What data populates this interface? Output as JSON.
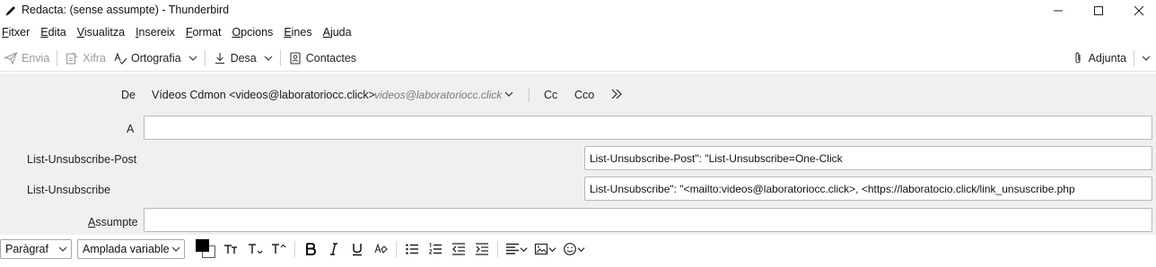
{
  "window": {
    "title": "Redacta: (sense assumpte) - Thunderbird"
  },
  "menubar": {
    "items": [
      {
        "accel": "F",
        "rest": "itxer"
      },
      {
        "accel": "E",
        "rest": "dita"
      },
      {
        "accel": "V",
        "rest": "isualitza"
      },
      {
        "accel": "I",
        "rest": "nsereix"
      },
      {
        "accel": "F",
        "rest": "ormat"
      },
      {
        "accel": "O",
        "rest": "pcions"
      },
      {
        "accel": "E",
        "rest": "ines"
      },
      {
        "accel": "A",
        "rest": "juda"
      }
    ]
  },
  "toolbar": {
    "send_label": "Envia",
    "encrypt_label": "Xifra",
    "spelling_label": "Ortografia",
    "save_label": "Desa",
    "contacts_label": "Contactes",
    "attach_label": "Adjunta"
  },
  "header": {
    "from_label": "De",
    "from_identity": "Vídeos Cdmon <videos@laboratoriocc.click>",
    "from_email": "videos@laboratoriocc.click",
    "cc_label": "Cc",
    "bcc_label": "Cco",
    "to_label": "A",
    "to_value": "",
    "custom_headers": [
      {
        "label": "List-Unsubscribe-Post",
        "value": "List-Unsubscribe-Post\": \"List-Unsubscribe=One-Click"
      },
      {
        "label": "List-Unsubscribe",
        "value": "List-Unsubscribe\": \"<mailto:videos@laboratoriocc.click>, <https://laboratocio.click/link_unsuscribe.php"
      }
    ],
    "subject_label_accel": "A",
    "subject_label_rest": "ssumpte",
    "subject_value": ""
  },
  "formatbar": {
    "paragraph_format": "Paràgraf",
    "font": "Amplada variable",
    "text_color": "#000000",
    "background_color": "#ffffff"
  }
}
